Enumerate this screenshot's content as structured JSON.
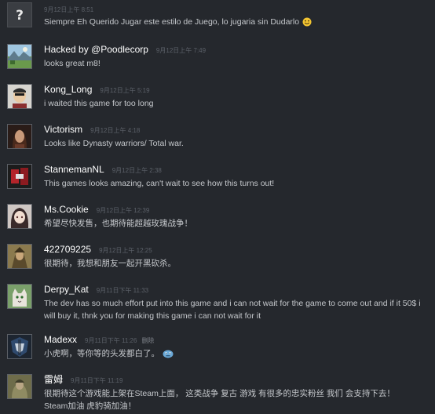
{
  "comments": [
    {
      "author": "",
      "time": "9月12日上午 8:51",
      "text": "Siempre Eh Querido Jugar este estilo de Juego, lo jugaria sin Dudarlo",
      "emoji": "smiley-emoticon",
      "avatar": "question-mark-avatar"
    },
    {
      "author": "Hacked by @Poodlecorp",
      "time": "9月12日上午 7:49",
      "text": "looks great m8!",
      "avatar": "landscape-avatar"
    },
    {
      "author": "Kong_Long",
      "time": "9月12日上午 5:19",
      "text": "i waited this game for too long",
      "avatar": "character-avatar"
    },
    {
      "author": "Victorism",
      "time": "9月12日上午 4:18",
      "text": "Looks like Dynasty warriors/ Total war.",
      "avatar": "portrait-avatar"
    },
    {
      "author": "StannemanNL",
      "time": "9月12日上午 2:38",
      "text": "This games looks amazing, can't wait to see how this turns out!",
      "avatar": "red-abstract-avatar"
    },
    {
      "author": "Ms.Cookie",
      "time": "9月12日上午 12:39",
      "text": "希望尽快发售，也期待能超越玫瑰战争！",
      "avatar": "anime-avatar"
    },
    {
      "author": "422709225",
      "time": "9月12日上午 12:25",
      "text": "很期待，我想和朋友一起开黑砍杀。",
      "avatar": "warrior-avatar"
    },
    {
      "author": "Derpy_Kat",
      "time": "9月11日下午 11:33",
      "text": "The dev has so much effort put into this game and i can not wait for the game to come out and if it 50$ i will buy it, thnk you for making this game i can not wait for it",
      "avatar": "cat-avatar"
    },
    {
      "author": "Madexx",
      "time": "9月11日下午 11:26",
      "delete": "删除",
      "text": "小虎啊，等你等的头发都白了。",
      "emoji": "blue-emoticon",
      "avatar": "shield-logo-avatar"
    },
    {
      "author": "雷姆",
      "time": "9月11日下午 11:19",
      "text": "很期待这个游戏能上架在Steam上面， 这类战争 复古 游戏 有很多的忠实粉丝 我们 会支持下去！\nSteam加油 虎豹骑加油！",
      "avatar": "armored-figure-avatar"
    }
  ]
}
